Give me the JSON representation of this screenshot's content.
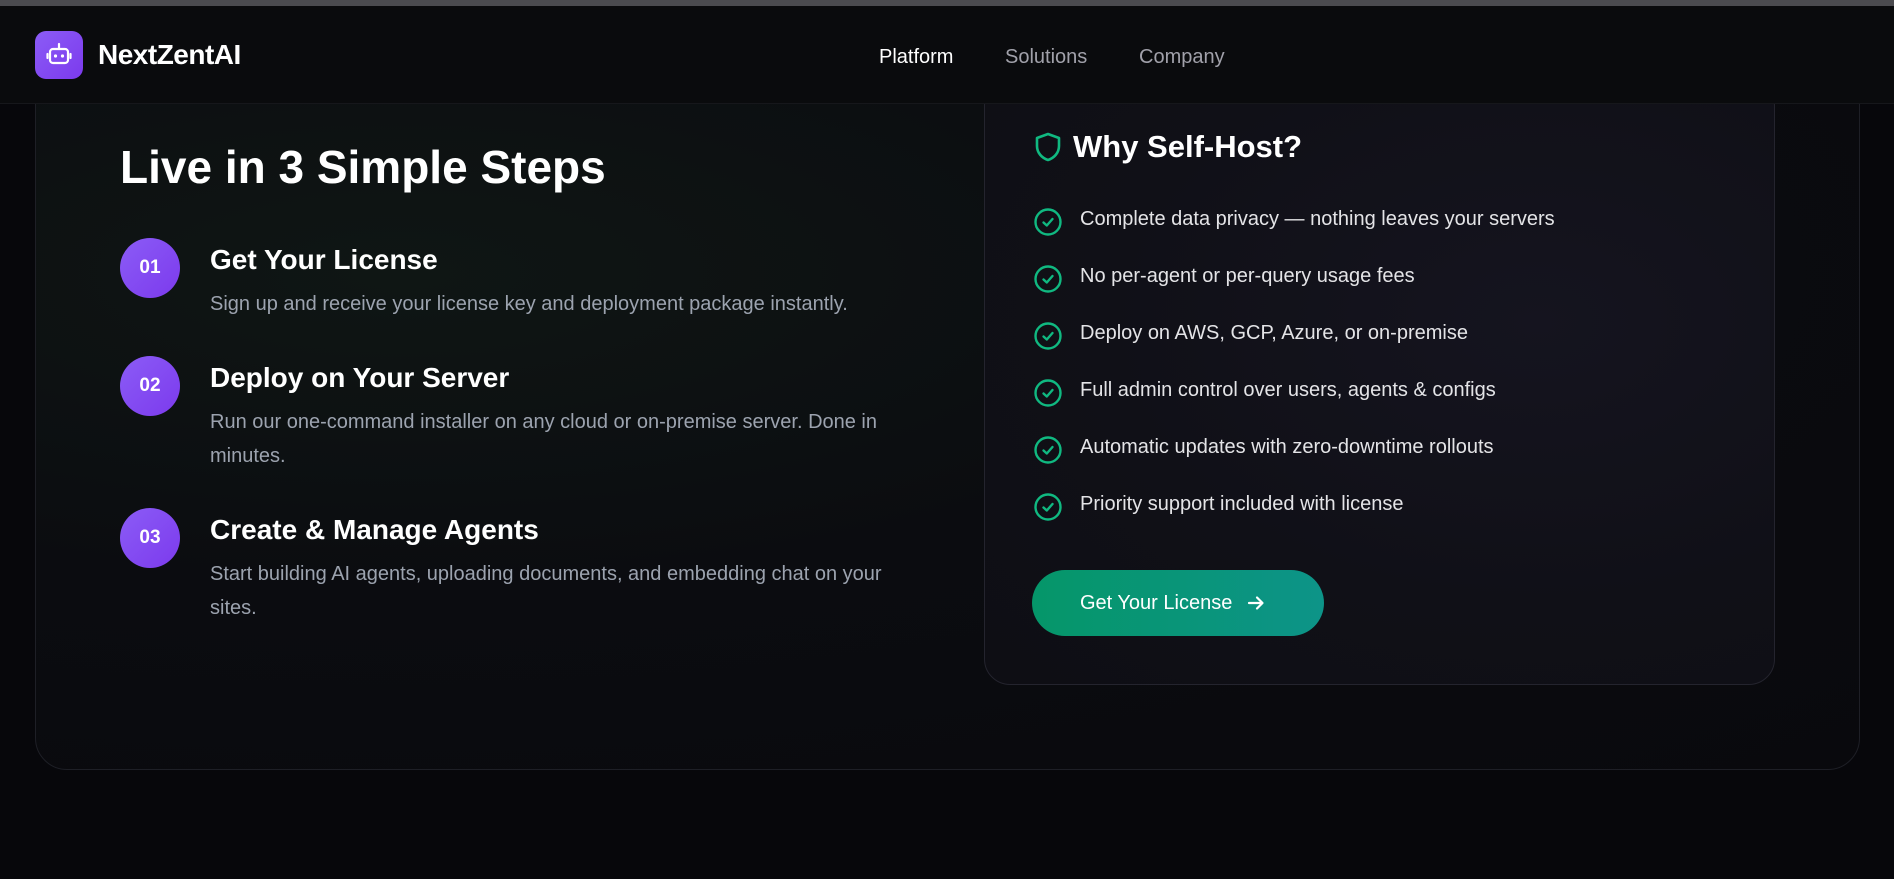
{
  "header": {
    "brand": "NextZentAI",
    "nav": [
      "Platform",
      "Solutions",
      "Company"
    ],
    "active_nav": "Platform"
  },
  "steps": {
    "title": "Live in 3 Simple Steps",
    "items": [
      {
        "number": "01",
        "title": "Get Your License",
        "description": "Sign up and receive your license key and deployment package instantly."
      },
      {
        "number": "02",
        "title": "Deploy on Your Server",
        "description": "Run our one-command installer on any cloud or on-premise server. Done in minutes."
      },
      {
        "number": "03",
        "title": "Create & Manage Agents",
        "description": "Start building AI agents, uploading documents, and embedding chat on your sites."
      }
    ]
  },
  "why": {
    "title": "Why Self-Host?",
    "benefits": [
      "Complete data privacy — nothing leaves your servers",
      "No per-agent or per-query usage fees",
      "Deploy on AWS, GCP, Azure, or on-premise",
      "Full admin control over users, agents & configs",
      "Automatic updates with zero-downtime rollouts",
      "Priority support included with license"
    ],
    "cta_label": "Get Your License"
  },
  "icons": {
    "logo": "robot-icon",
    "why": "shield-icon",
    "benefit": "check-circle-icon",
    "cta": "arrow-right-icon"
  },
  "colors": {
    "accent_purple": "#8b5cf6",
    "accent_green": "#10b981",
    "cta_gradient_start": "#059669",
    "cta_gradient_end": "#0d9488"
  }
}
